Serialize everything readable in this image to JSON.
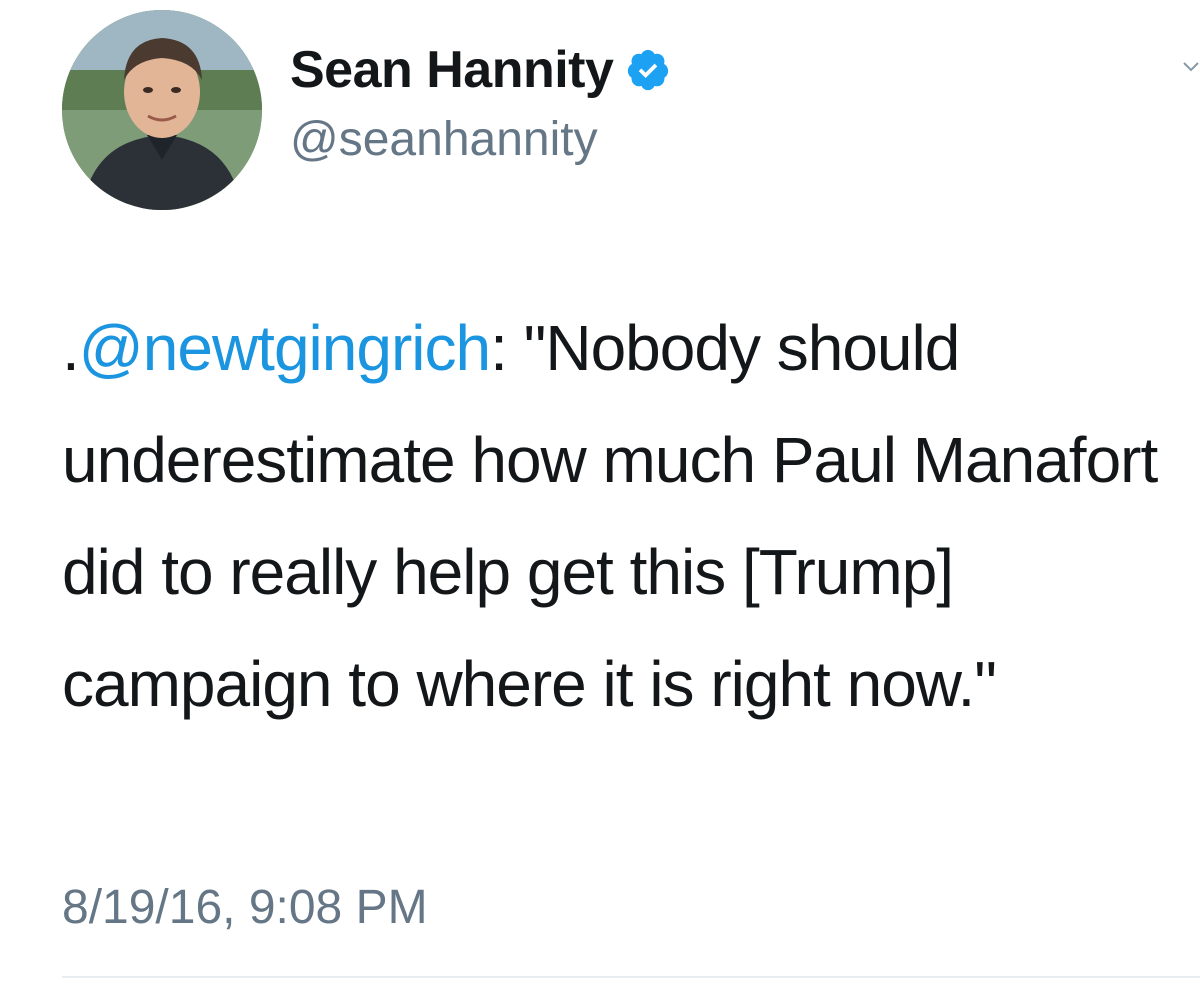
{
  "author": {
    "name": "Sean Hannity",
    "handle": "@seanhannity",
    "verified": true
  },
  "tweet": {
    "prefix": ".",
    "mention": "@newtgingrich",
    "text": ": \"Nobody should underestimate how much Paul Manafort did to really help get this [Trump] campaign to where it is right now.\"",
    "timestamp": "8/19/16, 9:08 PM"
  },
  "icons": {
    "verified_badge": "verified-check-icon",
    "menu_caret": "chevron-down-icon"
  },
  "colors": {
    "text": "#14171a",
    "secondary": "#657786",
    "link": "#1b95e0",
    "verified": "#1da1f2"
  }
}
